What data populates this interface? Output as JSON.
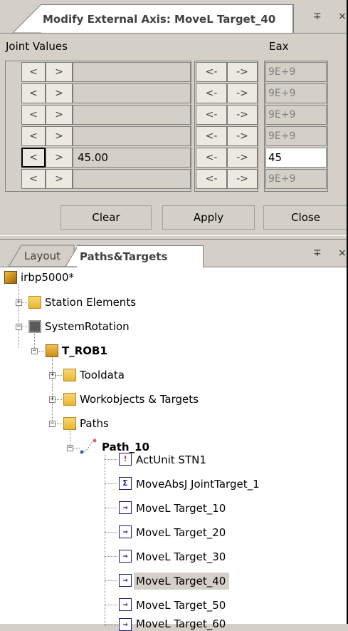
{
  "modify_panel": {
    "tab_title": "Modify External Axis: MoveL  Target_40",
    "pin_glyph": "∓",
    "close_glyph": "×",
    "joint_values_label": "Joint Values",
    "eax_label": "Eax",
    "left_arrow": "<",
    "right_arrow": ">",
    "step_left": "<-",
    "step_right": "->",
    "rows": [
      {
        "value": "",
        "eax": "9E+9",
        "eax_active": false
      },
      {
        "value": "",
        "eax": "9E+9",
        "eax_active": false
      },
      {
        "value": "",
        "eax": "9E+9",
        "eax_active": false
      },
      {
        "value": "",
        "eax": "9E+9",
        "eax_active": false
      },
      {
        "value": "45.00",
        "eax": "45",
        "eax_active": true
      },
      {
        "value": "",
        "eax": "9E+9",
        "eax_active": false
      }
    ],
    "buttons": {
      "clear": "Clear",
      "apply": "Apply",
      "close": "Close"
    }
  },
  "tree_panel": {
    "tabs": {
      "layout": "Layout",
      "paths_targets": "Paths&Targets"
    },
    "pin_glyph": "∓",
    "close_glyph": "×",
    "root": "irbp5000*",
    "station_elements": "Station Elements",
    "system": "SystemRotation",
    "task": "T_ROB1",
    "tooldata": "Tooldata",
    "workobjects": "Workobjects & Targets",
    "paths": "Paths",
    "path": "Path_10",
    "instructions": [
      {
        "label": "ActUnit  STN1",
        "icon": "!"
      },
      {
        "label": "MoveAbsJ  JointTarget_1",
        "icon": "Σ"
      },
      {
        "label": "MoveL  Target_10",
        "icon": "→"
      },
      {
        "label": "MoveL  Target_20",
        "icon": "→"
      },
      {
        "label": "MoveL  Target_30",
        "icon": "→"
      },
      {
        "label": "MoveL  Target_40",
        "icon": "→"
      },
      {
        "label": "MoveL  Target_50",
        "icon": "→"
      },
      {
        "label": "MoveL  Target_60",
        "icon": "→"
      }
    ],
    "selected_instruction": "MoveL  Target_40"
  }
}
